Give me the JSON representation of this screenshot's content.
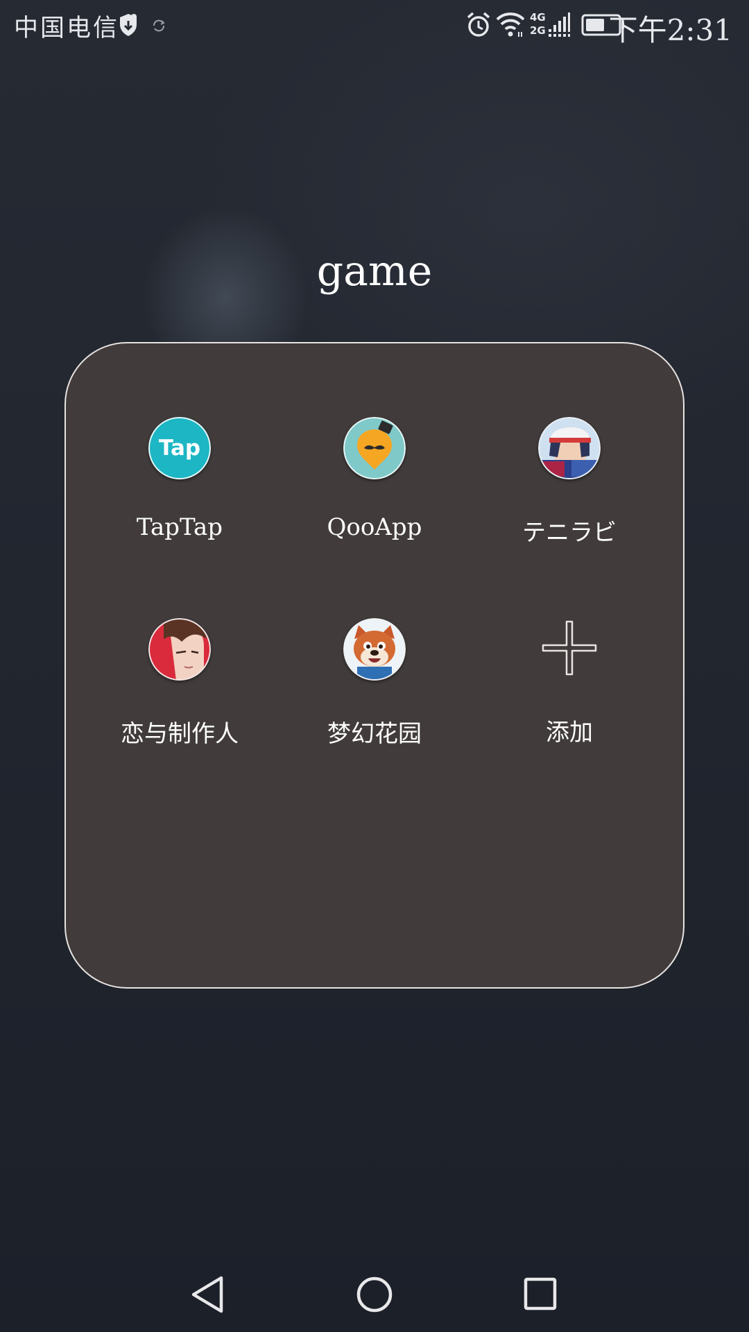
{
  "status_bar": {
    "carrier": "中国电信",
    "time": "下午2:31",
    "network_top": "4G",
    "network_bottom": "2G",
    "icons": [
      "shield-icon",
      "sync-icon",
      "alarm-icon",
      "wifi-icon",
      "signal-icon",
      "battery-icon"
    ],
    "battery_level": 0.6
  },
  "folder": {
    "title": "game",
    "apps": [
      {
        "label": "TapTap",
        "icon": "taptap-icon",
        "icon_text": "Tap",
        "color": "#1cb6c4"
      },
      {
        "label": "QooApp",
        "icon": "qooapp-icon",
        "color": "#f5a623"
      },
      {
        "label": "テニラビ",
        "icon": "tennis-anime-icon"
      },
      {
        "label": "恋与制作人",
        "icon": "love-producer-icon"
      },
      {
        "label": "梦幻花园",
        "icon": "dream-garden-icon"
      },
      {
        "label": "添加",
        "icon": "add-icon"
      }
    ]
  },
  "nav_bar": {
    "buttons": [
      "back-icon",
      "home-icon",
      "recents-icon"
    ]
  },
  "colors": {
    "panel_bg": "#413c3b",
    "panel_border": "#e8e4e2",
    "accent_teal": "#1cb6c4",
    "accent_orange": "#f5a623"
  }
}
